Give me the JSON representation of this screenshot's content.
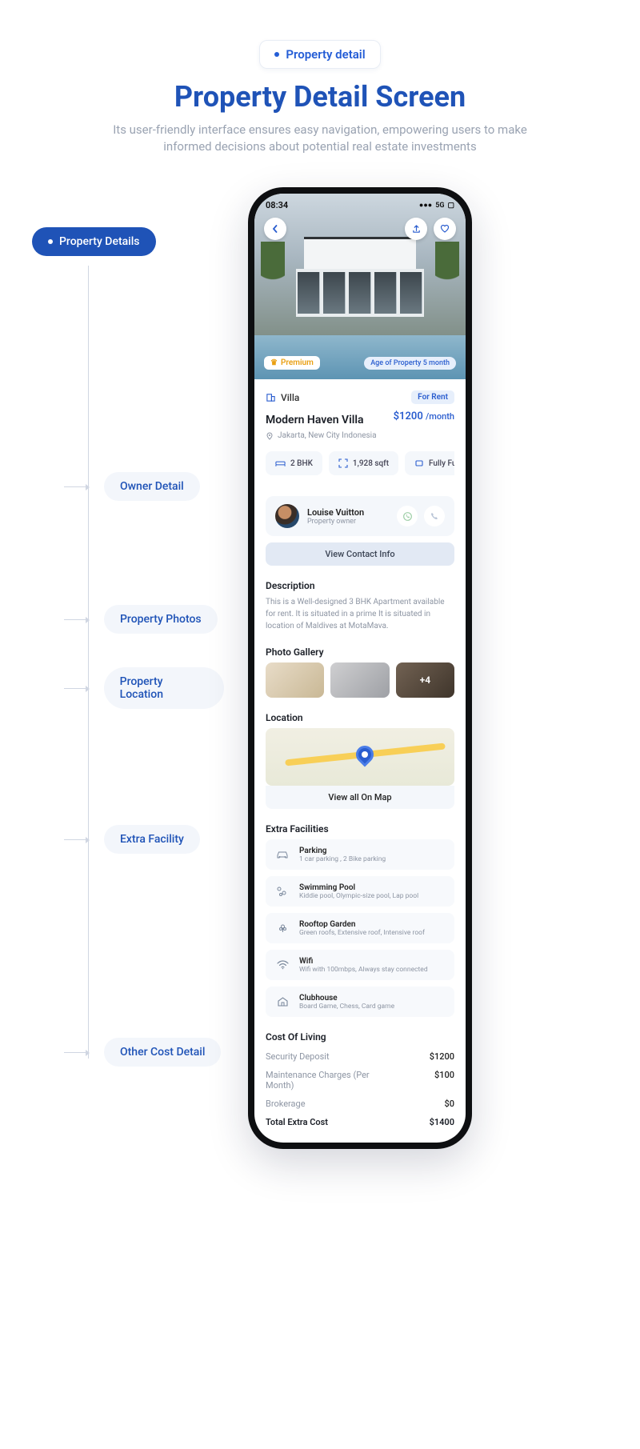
{
  "header": {
    "badge": "Property detail",
    "title": "Property Detail Screen",
    "subtitle": "Its user-friendly interface ensures easy navigation, empowering users to make informed decisions about potential real estate investments"
  },
  "timeline": {
    "active": "Property Details",
    "items": [
      "Owner Detail",
      "Property Photos",
      "Property Location",
      "Extra Facility",
      "Other Cost Detail"
    ]
  },
  "phone": {
    "status": {
      "time": "08:34",
      "net": "5G"
    },
    "hero": {
      "premium": "Premium",
      "age": "Age of Property 5 month"
    },
    "info": {
      "type": "Villa",
      "forRent": "For Rent",
      "name": "Modern Haven Villa",
      "price": "$1200",
      "per": "/month",
      "location": "Jakarta, New City Indonesia",
      "chips": [
        "2 BHK",
        "1,928 sqft",
        "Fully Fu"
      ]
    },
    "owner": {
      "name": "Louise Vuitton",
      "role": "Property owner",
      "viewContact": "View Contact Info"
    },
    "description": {
      "heading": "Description",
      "text": "This is a Well-designed 3 BHK Apartment available for rent. It is situated in a prime It is situated in location of Maldives at MotaMava."
    },
    "gallery": {
      "heading": "Photo Gallery",
      "more": "+4"
    },
    "location": {
      "heading": "Location",
      "button": "View all On Map"
    },
    "facilities": {
      "heading": "Extra Facilities",
      "items": [
        {
          "title": "Parking",
          "sub": "1 car parking , 2 Bike parking"
        },
        {
          "title": "Swimming Pool",
          "sub": "Kiddie pool, Olympic-size pool, Lap pool"
        },
        {
          "title": "Rooftop Garden",
          "sub": "Green roofs, Extensive roof, Intensive roof"
        },
        {
          "title": "Wifi",
          "sub": "Wifi with 100mbps, Always stay connected"
        },
        {
          "title": "Clubhouse",
          "sub": "Board Game, Chess, Card game"
        }
      ]
    },
    "cost": {
      "heading": "Cost Of Living",
      "rows": [
        {
          "label": "Security Deposit",
          "value": "$1200"
        },
        {
          "label": "Maintenance Charges (Per Month)",
          "value": "$100"
        },
        {
          "label": "Brokerage",
          "value": "$0"
        }
      ],
      "total": {
        "label": "Total Extra Cost",
        "value": "$1400"
      }
    }
  }
}
